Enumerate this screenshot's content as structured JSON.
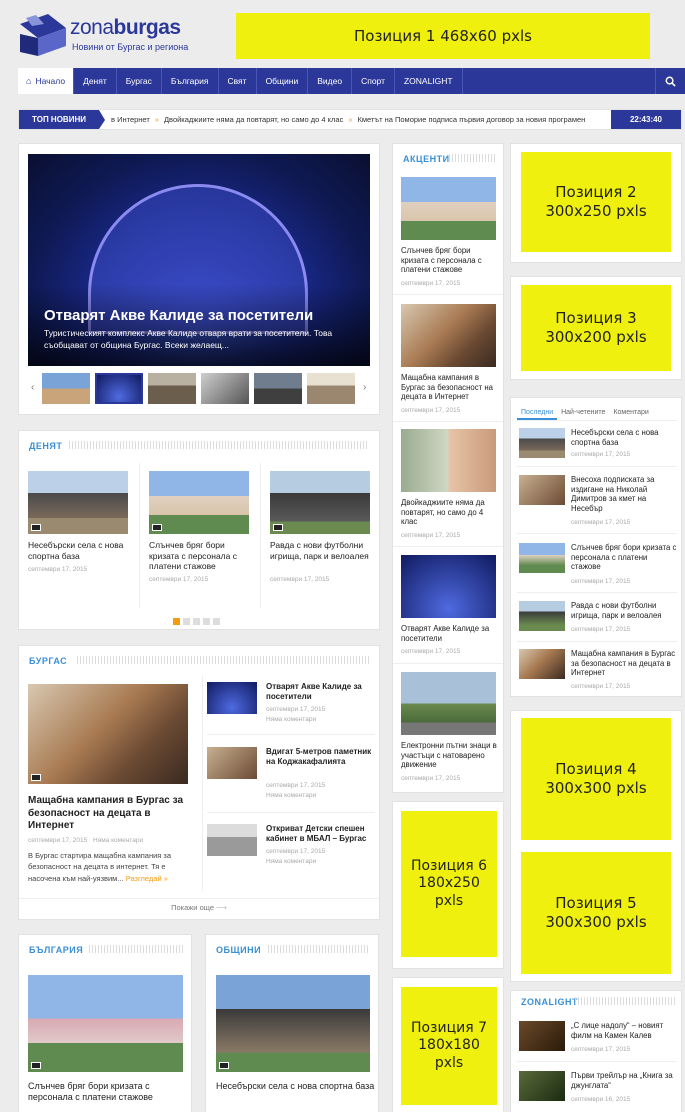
{
  "logo": {
    "name_part1": "zona",
    "name_part2": "burgas",
    "tagline": "Новини от Бургас и региона"
  },
  "ads": {
    "pos1": "Позиция 1 468x60 pxls",
    "pos2": "Позиция 2\n300x250 pxls",
    "pos3": "Позиция 3\n300x200 pxls",
    "pos4": "Позиция 4\n300x300 pxls",
    "pos5": "Позиция 5\n300x300 pxls",
    "pos6": "Позиция 6\n180x250\npxls",
    "pos7": "Позиция 7\n180x180\npxls"
  },
  "nav": {
    "items": [
      "Начало",
      "Денят",
      "Бургас",
      "България",
      "Свят",
      "Общини",
      "Видео",
      "Спорт",
      "ZONALIGHT"
    ],
    "search_icon": "search-icon"
  },
  "ticker": {
    "label": "ТОП НОВИНИ",
    "items": [
      "в Интернет",
      "Двойкаджиите няма да повтарят, но само до 4 клас",
      "Кметът на Поморие подписа първия договор за новия програмен"
    ],
    "time": "22:43:40"
  },
  "featured": {
    "title": "Отварят Акве Калиде за посетители",
    "excerpt": "Туристическият комплекс Акве Калиде отваря врати за посетители. Това съобщават от община Бургас. Всеки желаещ..."
  },
  "denyat": {
    "title": "ДЕНЯТ",
    "items": [
      {
        "title": "Несебърски села с нова спортна база",
        "date": "септември 17, 2015"
      },
      {
        "title": "Слънчев бряг бори кризата с персонала с платени стажове",
        "date": "септември 17, 2015"
      },
      {
        "title": "Равда с нови футболни игрища, парк и велоалея",
        "date": "септември 17, 2015"
      }
    ]
  },
  "burgas": {
    "title": "БУРГАС",
    "main": {
      "title": "Мащабна кампания в Бургас за безопасност на децата в Интернет",
      "date": "септември 17, 2015",
      "comments": "Няма коментари",
      "excerpt": "В Бургас стартира мащабна кампания за безопасност на децата в интернет. Тя е насочена към най-уязвим...",
      "more": "Разгледай »"
    },
    "side": [
      {
        "title": "Отварят Акве Калиде за посетители",
        "date": "септември 17, 2015",
        "comments": "Няма коментари"
      },
      {
        "title": "Вдигат 5-метров паметник на Коджакафалията",
        "date": "септември 17, 2015",
        "comments": "Няма коментари"
      },
      {
        "title": "Откриват Детски спешен кабинет в МБАЛ – Бургас",
        "date": "септември 17, 2015",
        "comments": "Няма коментари"
      }
    ],
    "show_more": "Покажи още"
  },
  "bulgaria": {
    "title": "БЪЛГАРИЯ",
    "item": {
      "title": "Слънчев бряг бори кризата с персонала с платени стажове"
    }
  },
  "obshtini": {
    "title": "ОБЩИНИ",
    "item": {
      "title": "Несебърски села с нова спортна база"
    }
  },
  "akcenti": {
    "title": "АКЦЕНТИ",
    "items": [
      {
        "title": "Слънчев бряг бори кризата с персонала с платени стажове",
        "date": "септември 17, 2015"
      },
      {
        "title": "Мащабна кампания в Бургас за безопасност на децата в Интернет",
        "date": "септември 17, 2015"
      },
      {
        "title": "Двойкаджиите няма да повтарят, но само до 4 клас",
        "date": "септември 17, 2015"
      },
      {
        "title": "Отварят Акве Калиде за посетители",
        "date": "септември 17, 2015"
      },
      {
        "title": "Електронни пътни знаци в участъци с натоварено движение",
        "date": "септември 17, 2015"
      }
    ]
  },
  "tabs": {
    "labels": [
      "Последни",
      "Най-четените",
      "Коментари"
    ],
    "items": [
      {
        "title": "Несебърски села с нова спортна база",
        "date": "септември 17, 2015"
      },
      {
        "title": "Внесоха подписката за издигане на Николай Димитров за кмет на Несебър",
        "date": "септември 17, 2015"
      },
      {
        "title": "Слънчев бряг бори кризата с персонала с платени стажове",
        "date": "септември 17, 2015"
      },
      {
        "title": "Равда с нови футболни игрища, парк и велоалея",
        "date": "септември 17, 2015"
      },
      {
        "title": "Мащабна кампания в Бургас за безопасност на децата в Интернет",
        "date": "септември 17, 2015"
      }
    ]
  },
  "zonalight": {
    "title": "ZONALIGHT",
    "items": [
      {
        "title": "„С лице надолу“ – новият филм на Камен Калев",
        "date": "септември 17, 2015"
      },
      {
        "title": "Първи трейлър на „Книга за джунглата“",
        "date": "септември 16, 2015"
      }
    ]
  },
  "colors": {
    "nav": "#2b3899",
    "accent": "#3a8fd6",
    "ad": "#f0f00f",
    "more": "#f39c12"
  }
}
